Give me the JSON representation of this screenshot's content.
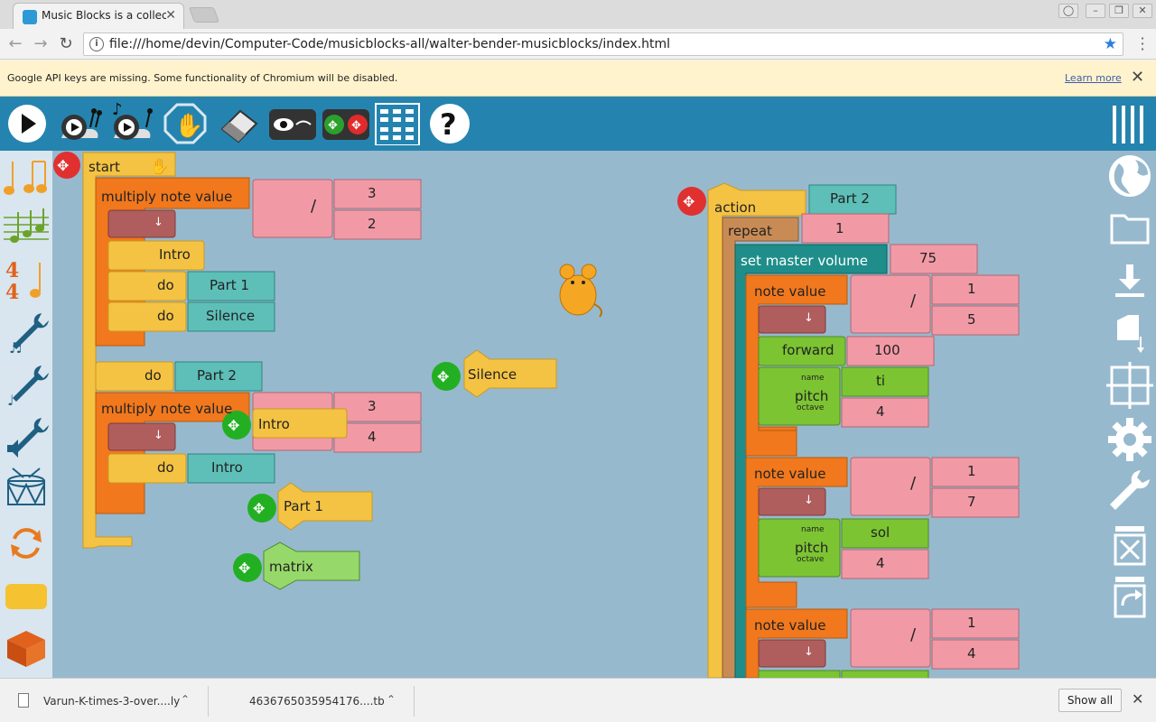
{
  "browser": {
    "tab_title": "Music Blocks is a collection",
    "url": "file:///home/devin/Computer-Code/musicblocks-all/walter-bender-musicblocks/index.html",
    "infobar_message": "Google API keys are missing. Some functionality of Chromium will be disabled.",
    "infobar_link": "Learn more"
  },
  "toolbar": {
    "buttons": [
      "play-icon",
      "run-slowly-icon",
      "run-music-slowly-icon",
      "stop-icon",
      "clear-icon",
      "hide-blocks-icon",
      "collapse-blocks-icon",
      "grid-menu-icon",
      "help-icon"
    ]
  },
  "palette": {
    "items": [
      "rhythm",
      "meter",
      "pitch",
      "tone",
      "intervals",
      "drum",
      "flow",
      "action",
      "extras"
    ]
  },
  "rightbar": {
    "items": [
      "globe-icon",
      "folder-icon",
      "save-icon",
      "new-file-icon",
      "grid-icon",
      "settings-icon",
      "wrench-icon",
      "trash-icon",
      "restore-icon"
    ]
  },
  "blocks": {
    "start": "start",
    "multiply_note_value": "multiply note value",
    "divide": "/",
    "mult1_num": "3",
    "mult1_den": "2",
    "arrow": "↓",
    "intro_label": "Intro",
    "do": "do",
    "part1": "Part 1",
    "silence_label": "Silence",
    "part2": "Part 2",
    "mult2_num": "3",
    "mult2_den": "4",
    "intro": "Intro",
    "float_intro": "Intro",
    "float_silence": "Silence",
    "float_part1": "Part 1",
    "float_matrix": "matrix",
    "action": "action",
    "action_name": "Part 2",
    "repeat": "repeat",
    "repeat_count": "1",
    "set_master_volume": "set master volume",
    "volume": "75",
    "note_value": "note value",
    "nv1_num": "1",
    "nv1_den": "5",
    "forward": "forward",
    "forward_val": "100",
    "name": "name",
    "pitch": "pitch",
    "octave": "octave",
    "pitch1_name": "ti",
    "pitch1_octave": "4",
    "nv2_num": "1",
    "nv2_den": "7",
    "pitch2_name": "sol",
    "pitch2_octave": "4",
    "nv3_num": "1",
    "nv3_den": "4"
  },
  "downloads": {
    "file1": "Varun-K-times-3-over....ly",
    "file2": "4636765035954176....tb",
    "show_all": "Show all"
  },
  "colors": {
    "toolbar": "#2584af",
    "canvas": "#97b9ce",
    "palette_bg": "#d9e6ef",
    "yellow": "#f5c343",
    "orange": "#f1781d",
    "pink": "#f19aa6",
    "teal": "#5dbfb8",
    "brown": "#b05d5d",
    "green": "#7cc432",
    "darkteal": "#1f8e8a",
    "tan": "#c98b55"
  }
}
